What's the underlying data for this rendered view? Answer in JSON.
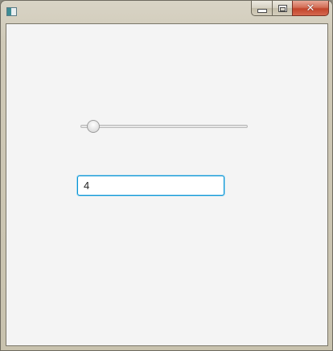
{
  "window": {
    "title": "",
    "icon": "app-window-icon",
    "caption_buttons": {
      "minimize_icon": "minimize-icon",
      "maximize_icon": "restore-icon",
      "close_symbol": "✕"
    }
  },
  "slider": {
    "min": 0,
    "max": 100,
    "value": 4
  },
  "text_field": {
    "value": "4"
  },
  "colors": {
    "focus_border": "#0793d4",
    "close_button": "#c2442b",
    "content_background": "#f4f4f4"
  }
}
